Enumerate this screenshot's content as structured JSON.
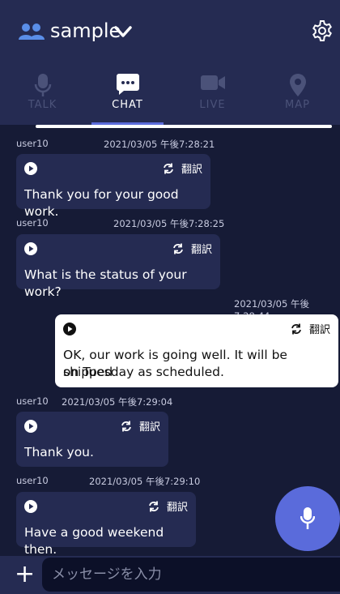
{
  "header": {
    "group_name": "sample",
    "icons": {
      "group": "group-icon",
      "dropdown": "chevron-down-icon",
      "settings": "gear-icon"
    }
  },
  "tabs": [
    {
      "label": "TALK",
      "icon": "microphone-icon",
      "active": false
    },
    {
      "label": "CHAT",
      "icon": "chat-bubble-icon",
      "active": true
    },
    {
      "label": "LIVE",
      "icon": "video-camera-icon",
      "active": false
    },
    {
      "label": "MAP",
      "icon": "map-pin-icon",
      "active": false
    }
  ],
  "messages": [
    {
      "user": "user10",
      "timestamp": "2021/03/05 午後7:28:21",
      "translate_label": "翻訳",
      "text": "Thank you for your good work.",
      "mine": false
    },
    {
      "user": "user10",
      "timestamp": "2021/03/05 午後7:28:25",
      "translate_label": "翻訳",
      "text": "What is the status of your work?",
      "mine": false
    },
    {
      "user": "",
      "timestamp": "2021/03/05 午後7:28:44",
      "translate_label": "翻訳",
      "text_line1": "OK, our work is going well. It will be shipped",
      "text_line2": "on Tuesday as scheduled.",
      "mine": true
    },
    {
      "user": "user10",
      "timestamp": "2021/03/05 午後7:29:04",
      "translate_label": "翻訳",
      "text": "Thank you.",
      "mine": false
    },
    {
      "user": "user10",
      "timestamp": "2021/03/05 午後7:29:10",
      "translate_label": "翻訳",
      "text": "Have a good weekend then.",
      "mine": false
    }
  ],
  "input": {
    "placeholder": "メッセージを入力",
    "value": "",
    "plus_label": "+"
  },
  "colors": {
    "background": "#161b36",
    "panel": "#252b52",
    "accent": "#5a6bdb",
    "inactive_tab": "#4b5279"
  }
}
